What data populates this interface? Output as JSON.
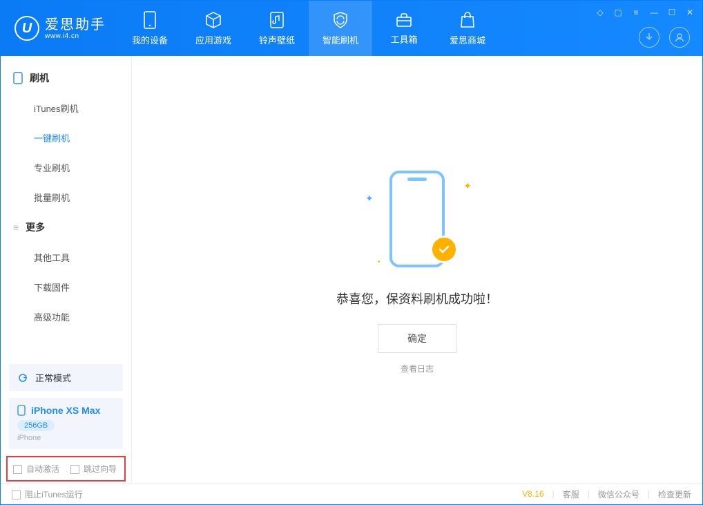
{
  "app": {
    "logo_title": "爱思助手",
    "logo_sub": "www.i4.cn"
  },
  "nav": {
    "tabs": [
      {
        "label": "我的设备"
      },
      {
        "label": "应用游戏"
      },
      {
        "label": "铃声壁纸"
      },
      {
        "label": "智能刷机"
      },
      {
        "label": "工具箱"
      },
      {
        "label": "爱思商城"
      }
    ]
  },
  "sidebar": {
    "group1_title": "刷机",
    "items1": [
      {
        "label": "iTunes刷机"
      },
      {
        "label": "一键刷机"
      },
      {
        "label": "专业刷机"
      },
      {
        "label": "批量刷机"
      }
    ],
    "group2_title": "更多",
    "items2": [
      {
        "label": "其他工具"
      },
      {
        "label": "下载固件"
      },
      {
        "label": "高级功能"
      }
    ],
    "mode_label": "正常模式",
    "device": {
      "name": "iPhone XS Max",
      "storage": "256GB",
      "type": "iPhone"
    },
    "checkbox1": "自动激活",
    "checkbox2": "跳过向导"
  },
  "main": {
    "success_text": "恭喜您，保资料刷机成功啦！",
    "ok_button": "确定",
    "log_link": "查看日志"
  },
  "footer": {
    "block_itunes": "阻止iTunes运行",
    "version": "V8.16",
    "service": "客服",
    "wechat": "微信公众号",
    "update": "检查更新"
  }
}
